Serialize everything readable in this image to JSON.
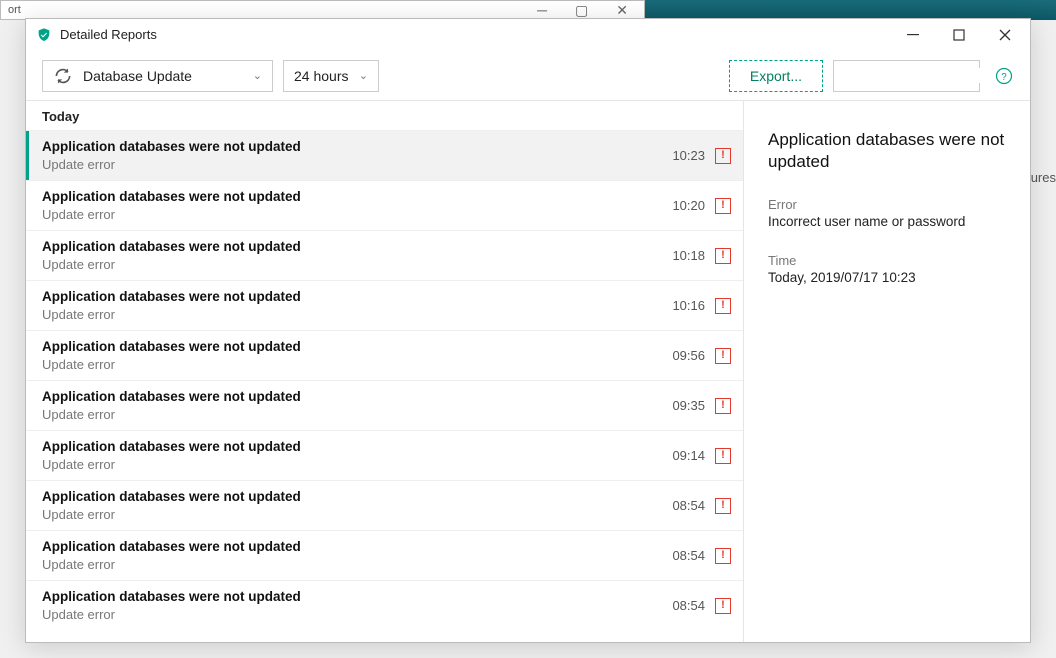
{
  "bg": {
    "title_fragment": "ort",
    "right_fragment": "ptures"
  },
  "window": {
    "title": "Detailed Reports",
    "toolbar": {
      "category": "Database Update",
      "range": "24 hours",
      "export": "Export...",
      "search_placeholder": ""
    },
    "section_header": "Today",
    "events": [
      {
        "title": "Application databases were not updated",
        "sub": "Update error",
        "time": "10:23",
        "selected": true
      },
      {
        "title": "Application databases were not updated",
        "sub": "Update error",
        "time": "10:20"
      },
      {
        "title": "Application databases were not updated",
        "sub": "Update error",
        "time": "10:18"
      },
      {
        "title": "Application databases were not updated",
        "sub": "Update error",
        "time": "10:16"
      },
      {
        "title": "Application databases were not updated",
        "sub": "Update error",
        "time": "09:56"
      },
      {
        "title": "Application databases were not updated",
        "sub": "Update error",
        "time": "09:35"
      },
      {
        "title": "Application databases were not updated",
        "sub": "Update error",
        "time": "09:14"
      },
      {
        "title": "Application databases were not updated",
        "sub": "Update error",
        "time": "08:54"
      },
      {
        "title": "Application databases were not updated",
        "sub": "Update error",
        "time": "08:54"
      },
      {
        "title": "Application databases were not updated",
        "sub": "Update error",
        "time": "08:54"
      }
    ],
    "detail": {
      "title": "Application databases were not updated",
      "error_label": "Error",
      "error_value": "Incorrect user name or password",
      "time_label": "Time",
      "time_value": "Today, 2019/07/17 10:23"
    }
  }
}
